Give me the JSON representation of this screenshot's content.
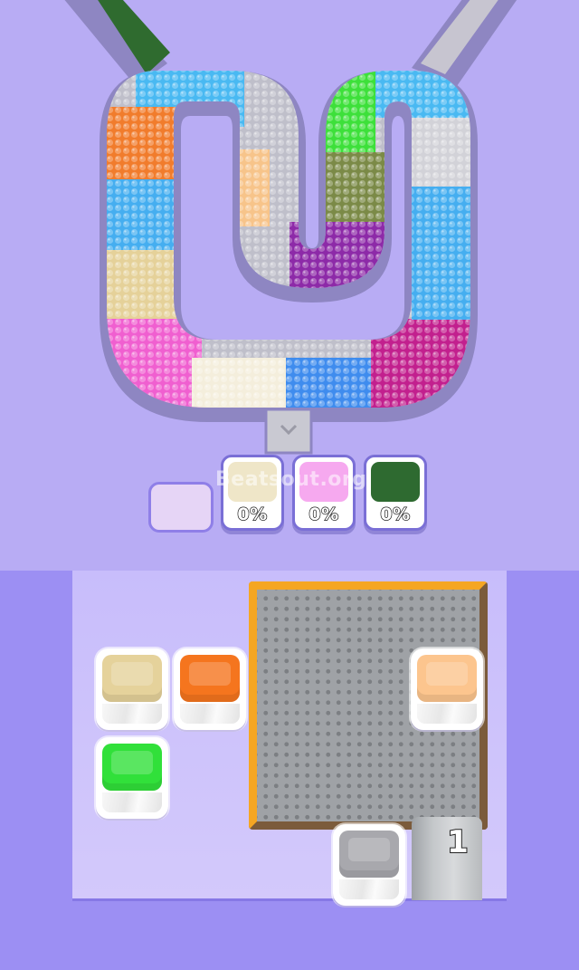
{
  "colors": {
    "background": "#b8acf4",
    "track_rim": "#8e86c2",
    "track_floor": "#bfbfca"
  },
  "watermark": "Beatsout.org",
  "conveyor_segments": [
    {
      "color": "dark-green",
      "hex": "#2f6b2f"
    },
    {
      "color": "sky-blue",
      "hex": "#49b9f2"
    },
    {
      "color": "orange",
      "hex": "#f17c2c"
    },
    {
      "color": "light-blue",
      "hex": "#45aef0"
    },
    {
      "color": "tan",
      "hex": "#e5d199"
    },
    {
      "color": "pink",
      "hex": "#f05fd0"
    },
    {
      "color": "cream",
      "hex": "#f4eedc"
    },
    {
      "color": "blue",
      "hex": "#3f8cee"
    },
    {
      "color": "magenta",
      "hex": "#c2208e"
    },
    {
      "color": "light-blue",
      "hex": "#45aef0"
    },
    {
      "color": "silver",
      "hex": "#d2d2d8"
    },
    {
      "color": "sky-blue",
      "hex": "#49b9f2"
    },
    {
      "color": "green",
      "hex": "#3de03a"
    },
    {
      "color": "olive",
      "hex": "#7b8a47"
    },
    {
      "color": "purple",
      "hex": "#8d2aa8"
    },
    {
      "color": "peach",
      "hex": "#f7c48a"
    }
  ],
  "collector_cups": [
    {
      "name": "cream-cup",
      "color": "#efe6c8",
      "percent": "0%"
    },
    {
      "name": "pink-cup",
      "color": "#f6a9ef",
      "percent": "0%"
    },
    {
      "name": "dark-green-cup",
      "color": "#2e6a30",
      "percent": "0%"
    }
  ],
  "boxes": [
    {
      "name": "box-tan",
      "color": "#e5d29b"
    },
    {
      "name": "box-orange",
      "color": "#f5751e"
    },
    {
      "name": "box-green",
      "color": "#31e03a"
    },
    {
      "name": "box-peach",
      "color": "#fcc58e"
    },
    {
      "name": "box-gray",
      "color": "#a8a8ad"
    }
  ],
  "dispenser": {
    "count": "1"
  }
}
